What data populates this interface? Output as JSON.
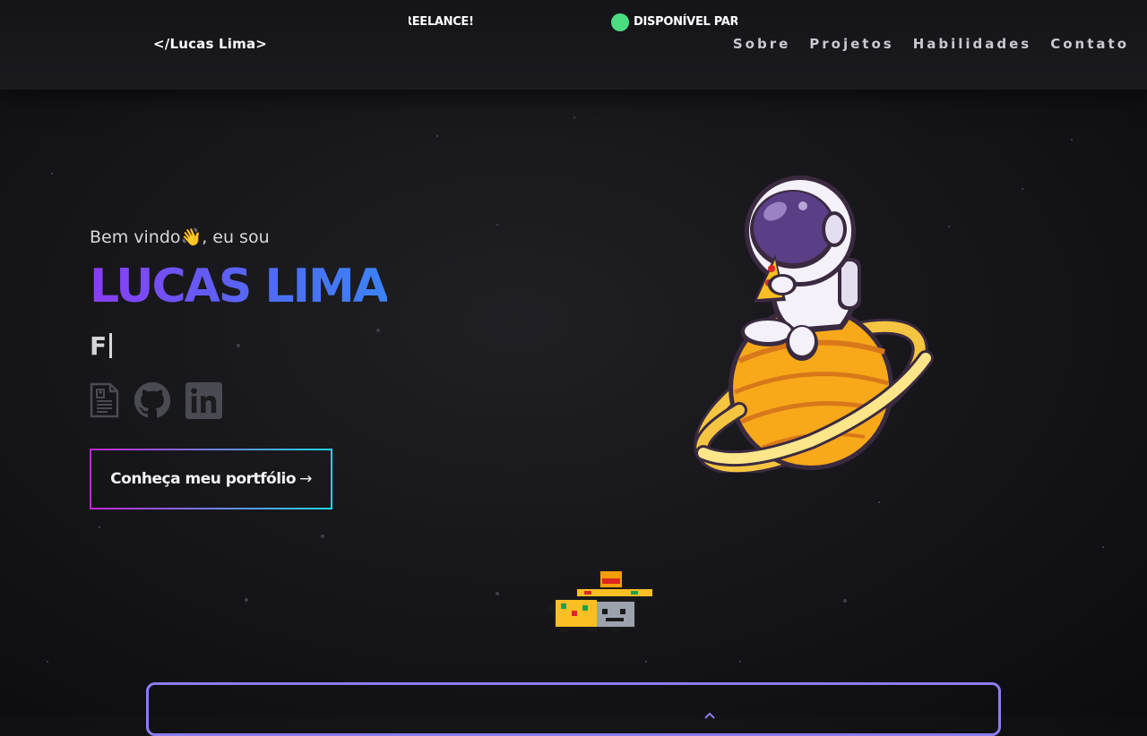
{
  "header": {
    "logo": "</Lucas Lima>",
    "ticker": {
      "text_left": "REELANCE!",
      "text_right": "DISPONÍVEL PARA",
      "dot_color": "#4ade80"
    },
    "nav": [
      "Sobre",
      "Projetos",
      "Habilidades",
      "Contato"
    ]
  },
  "hero": {
    "greeting_before": "Bem vindo",
    "greeting_emoji": "👋",
    "greeting_after": ", eu sou",
    "name": "LUCAS LIMA",
    "typed_text": "F",
    "socials": [
      {
        "icon": "resume-icon"
      },
      {
        "icon": "github-icon"
      },
      {
        "icon": "linkedin-icon"
      }
    ],
    "cta_label": "Conheça meu portfólio",
    "cta_arrow": "→"
  },
  "colors": {
    "name_gradient_start": "#8b3cf4",
    "name_gradient_end": "#3b82f6",
    "cta_border_start": "#c026d3",
    "cta_border_end": "#22d3ee",
    "bottom_card_border": "#8b7cf0"
  }
}
